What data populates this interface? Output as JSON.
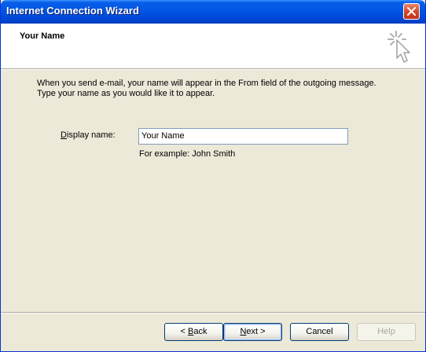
{
  "window": {
    "title": "Internet Connection Wizard"
  },
  "header": {
    "title": "Your Name",
    "icon": "wizard-cursor-icon"
  },
  "body": {
    "description_line1": "When you send e-mail, your name will appear in the From field of the outgoing message.",
    "description_line2": "Type your name as you would like it to appear.",
    "display_name_label_prefix": "",
    "display_name_label_underline": "D",
    "display_name_label_rest": "isplay name:",
    "display_name_value": "Your Name",
    "example_text": "For example: John Smith"
  },
  "buttons": {
    "back_prefix": "< ",
    "back_underline": "B",
    "back_rest": "ack",
    "next_underline": "N",
    "next_rest": "ext >",
    "cancel": "Cancel",
    "help": "Help"
  },
  "colors": {
    "titlebar": "#0055e5",
    "dialog_bg": "#ece9d8",
    "header_bg": "#ffffff",
    "close_button": "#d6492a"
  }
}
